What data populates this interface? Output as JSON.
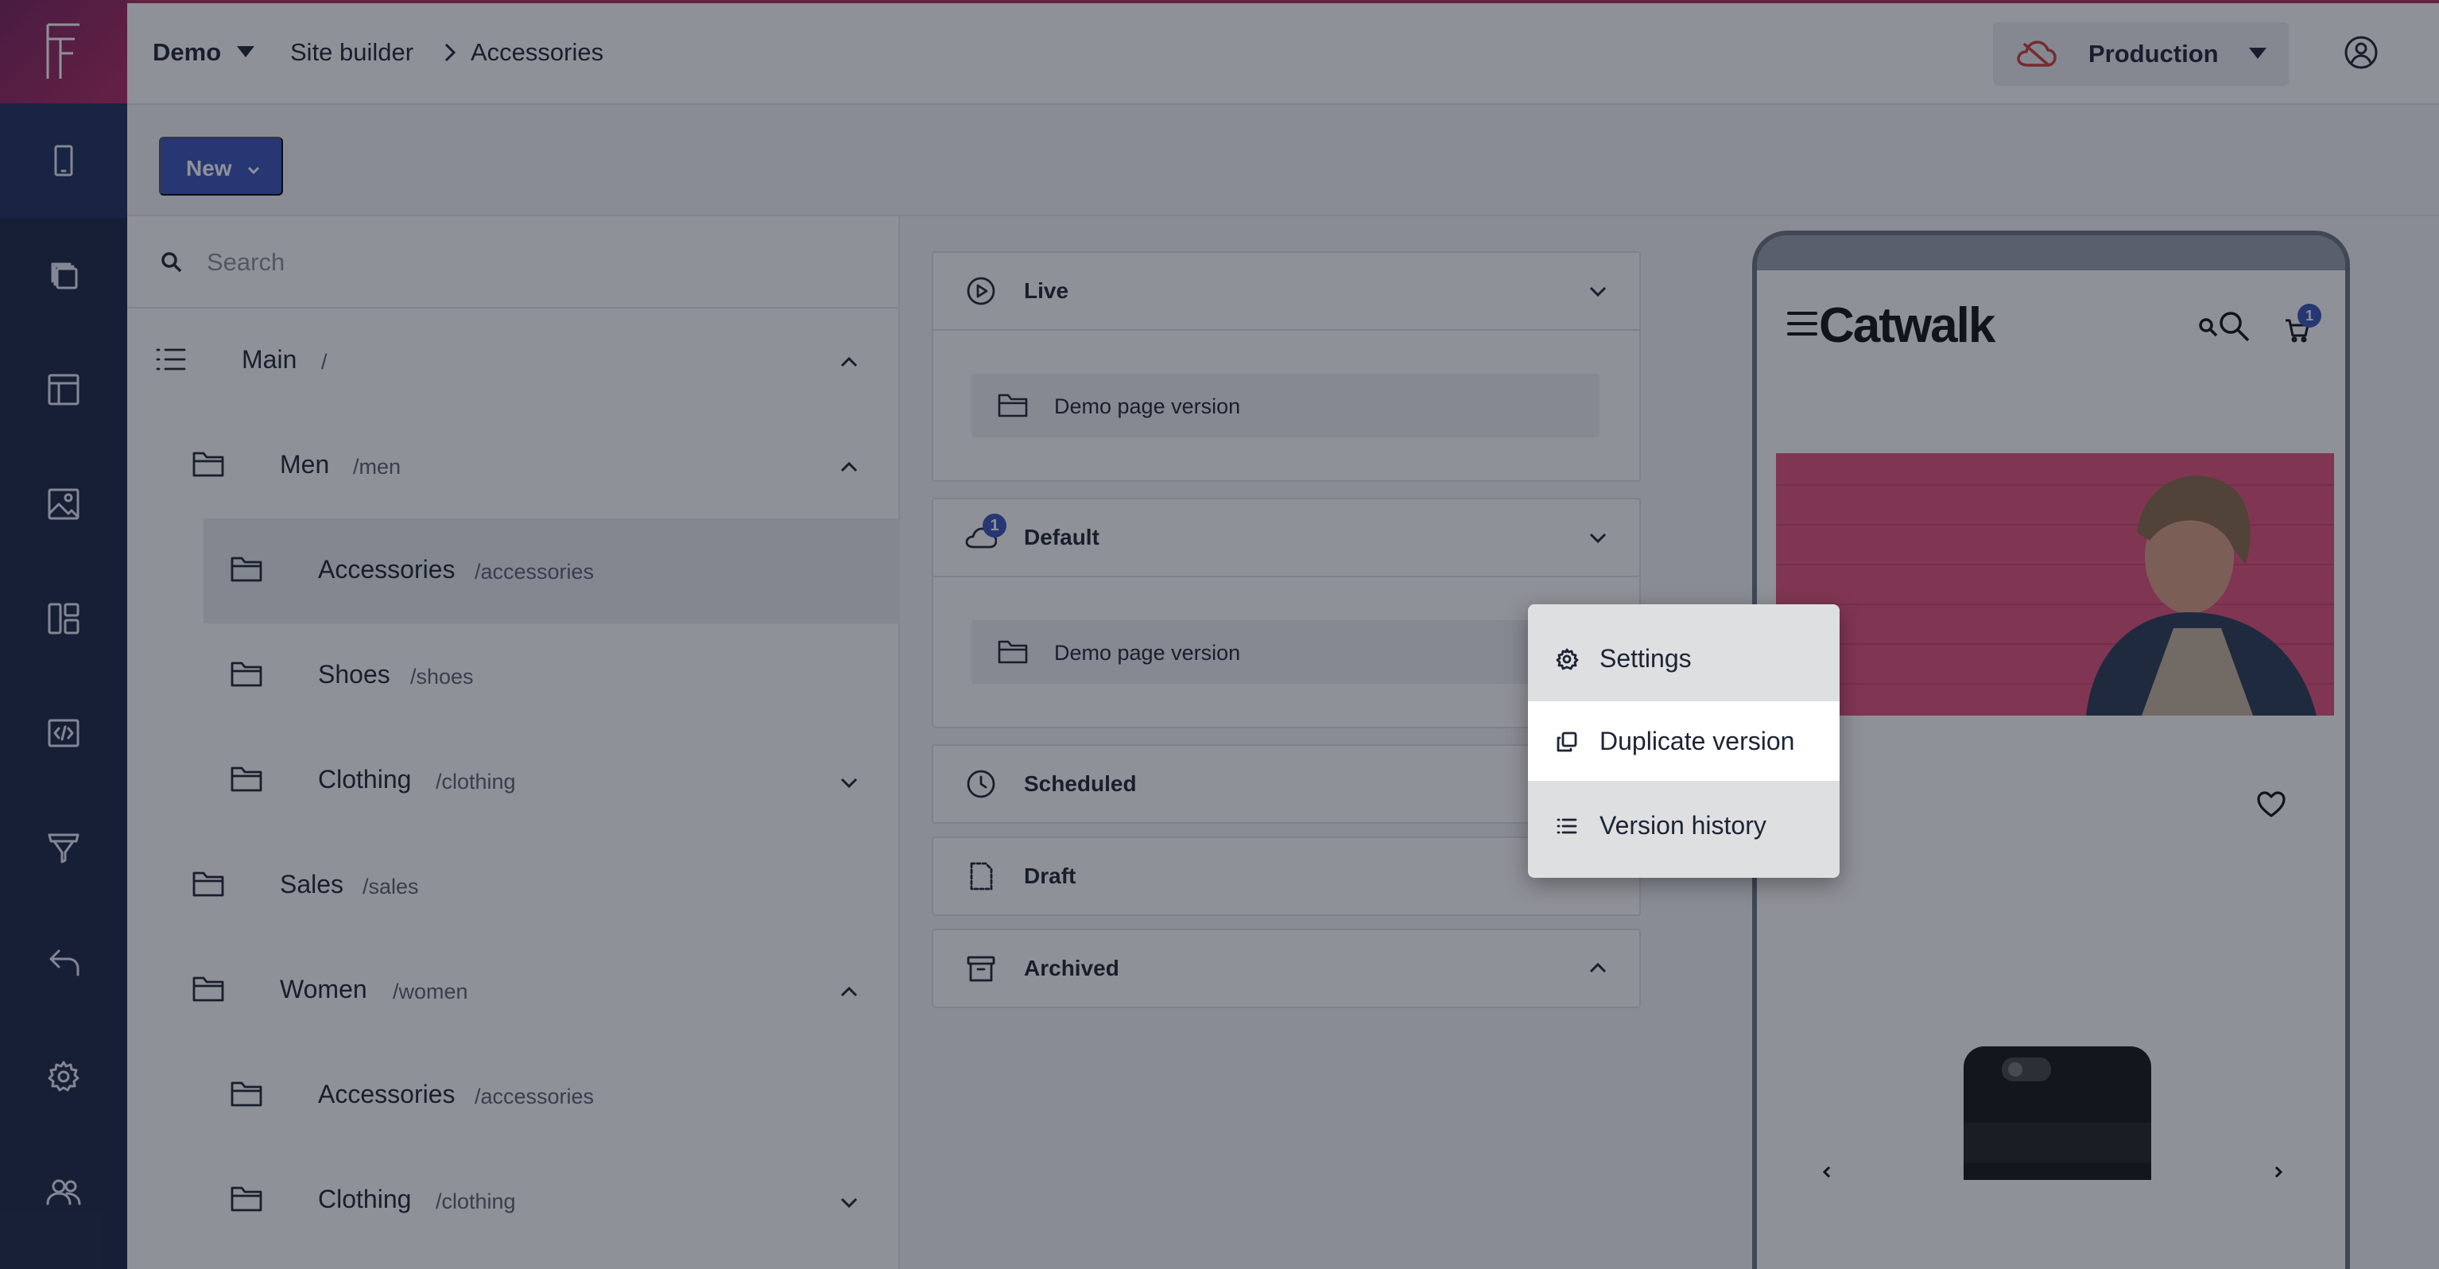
{
  "app": {
    "logo_letter": "F"
  },
  "header": {
    "workspace": "Demo",
    "breadcrumb": [
      "Site builder",
      "Accessories"
    ],
    "environment": "Production"
  },
  "toolbar": {
    "new_label": "New"
  },
  "tree": {
    "search_placeholder": "Search",
    "nodes": [
      {
        "name": "Main",
        "path": "/"
      },
      {
        "name": "Men",
        "path": "/men"
      },
      {
        "name": "Accessories",
        "path": "/accessories"
      },
      {
        "name": "Shoes",
        "path": "/shoes"
      },
      {
        "name": "Clothing",
        "path": "/clothing"
      },
      {
        "name": "Sales",
        "path": "/sales"
      },
      {
        "name": "Women",
        "path": "/women"
      },
      {
        "name": "Accessories",
        "path": "/accessories"
      },
      {
        "name": "Clothing",
        "path": "/clothing"
      }
    ]
  },
  "versions": {
    "live": {
      "title": "Live",
      "item": "Demo page version"
    },
    "default": {
      "title": "Default",
      "badge": "1",
      "item": "Demo page version"
    },
    "scheduled": {
      "title": "Scheduled"
    },
    "draft": {
      "title": "Draft"
    },
    "archived": {
      "title": "Archived"
    }
  },
  "context_menu": {
    "items": [
      "Settings",
      "Duplicate version",
      "Version history"
    ]
  },
  "preview": {
    "brand": "Catwalk",
    "cart_count": "1"
  },
  "colors": {
    "rail": "#1a2545",
    "logo_gradient_start": "#7a1f5c",
    "logo_gradient_end": "#b0285e",
    "primary_button": "#3654b8",
    "production_cloud": "#d23b3b",
    "hero_wall": "#e2517b"
  }
}
